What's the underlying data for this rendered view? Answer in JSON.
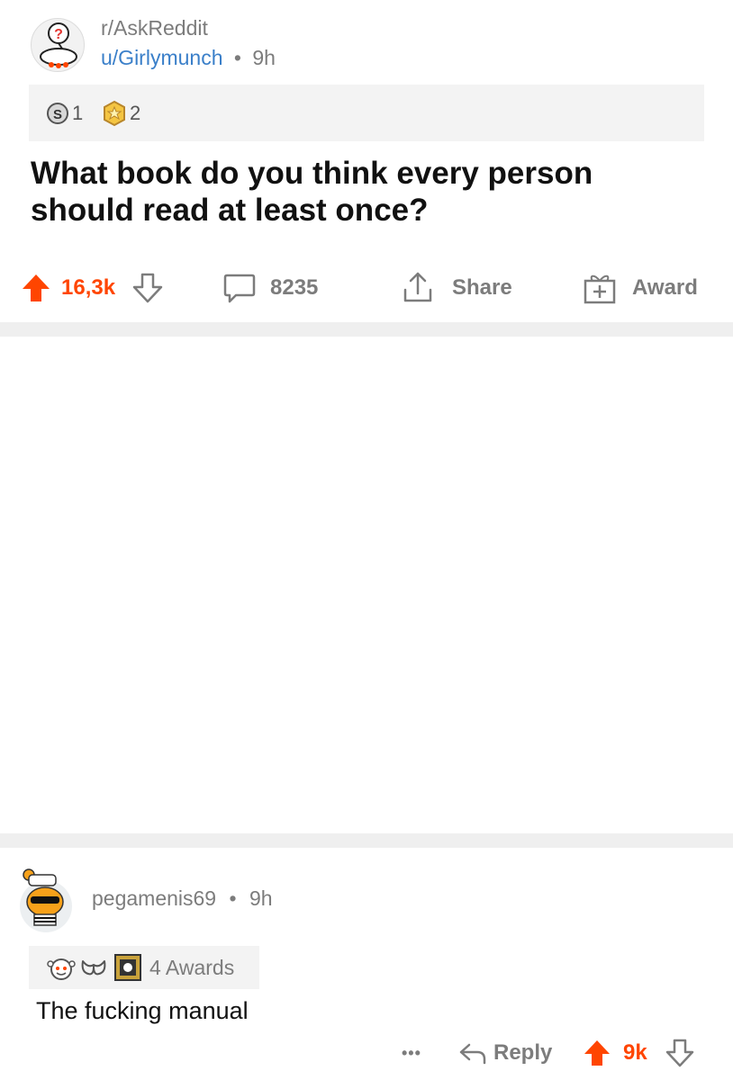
{
  "post": {
    "subreddit": "r/AskReddit",
    "author": "u/Girlymunch",
    "separator": "•",
    "age": "9h",
    "awards": [
      {
        "icon": "silver-award-icon",
        "count": "1"
      },
      {
        "icon": "gold-award-icon",
        "count": "2"
      }
    ],
    "title": "What book do you think every person should read at least once?",
    "score": "16,3k",
    "comments": "8235",
    "share_label": "Share",
    "award_label": "Award"
  },
  "comment": {
    "author": "pegamenis69",
    "separator": "•",
    "age": "9h",
    "awards_label": "4 Awards",
    "body": "The fucking manual",
    "more": "•••",
    "reply_label": "Reply",
    "score": "9k"
  },
  "colors": {
    "upvote": "#ff4500",
    "author_link": "#3a7fc9",
    "meta_text": "#7c7c7c",
    "band": "#efefef"
  }
}
